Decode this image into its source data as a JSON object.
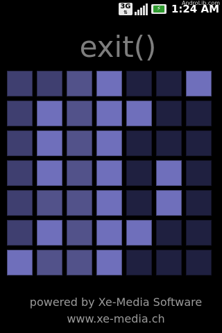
{
  "status_bar": {
    "watermark": "AndroLib.com",
    "network_label": "3G",
    "battery_icon": "battery-charging-icon",
    "time": "1:24 AM"
  },
  "title": "exit()",
  "board": {
    "rows": 7,
    "cols": 7,
    "colors": {
      "dark": "#1f2040",
      "medium": "#3f3f70",
      "medium_light": "#52528a",
      "bright": "#6f6fbb"
    },
    "cells": [
      [
        "medium",
        "medium",
        "medium_light",
        "bright",
        "dark",
        "dark",
        "bright"
      ],
      [
        "medium",
        "bright",
        "medium_light",
        "bright",
        "bright",
        "dark",
        "dark"
      ],
      [
        "medium",
        "bright",
        "medium_light",
        "bright",
        "dark",
        "dark",
        "dark"
      ],
      [
        "medium",
        "bright",
        "medium_light",
        "bright",
        "dark",
        "bright",
        "dark"
      ],
      [
        "medium",
        "medium_light",
        "medium_light",
        "bright",
        "dark",
        "bright",
        "dark"
      ],
      [
        "medium",
        "bright",
        "medium_light",
        "bright",
        "bright",
        "dark",
        "dark"
      ],
      [
        "bright",
        "medium_light",
        "medium_light",
        "bright",
        "dark",
        "dark",
        "dark"
      ]
    ]
  },
  "footer": {
    "line1": "powered by Xe-Media Software",
    "line2": "www.xe-media.ch"
  }
}
